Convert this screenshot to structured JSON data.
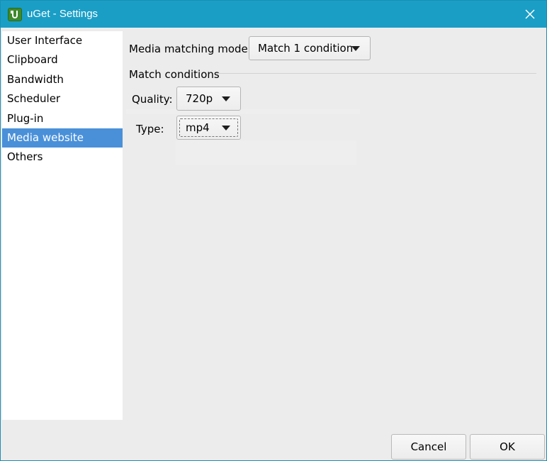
{
  "window": {
    "title": "uGet - Settings",
    "icon": "uget-app-icon",
    "close_icon": "close-icon"
  },
  "sidebar": {
    "items": [
      {
        "label": "User Interface",
        "selected": false
      },
      {
        "label": "Clipboard",
        "selected": false
      },
      {
        "label": "Bandwidth",
        "selected": false
      },
      {
        "label": "Scheduler",
        "selected": false
      },
      {
        "label": "Plug-in",
        "selected": false
      },
      {
        "label": "Media website",
        "selected": true
      },
      {
        "label": "Others",
        "selected": false
      }
    ]
  },
  "main": {
    "mode_label": "Media matching mode:",
    "mode_value": "Match 1 condition",
    "conditions_title": "Match conditions",
    "quality_label": "Quality:",
    "quality_value": "720p",
    "type_label": "Type:",
    "type_value": "mp4"
  },
  "footer": {
    "cancel_label": "Cancel",
    "ok_label": "OK"
  },
  "colors": {
    "titlebar": "#1a9ec6",
    "selection": "#4a90d9",
    "background": "#ececec"
  }
}
